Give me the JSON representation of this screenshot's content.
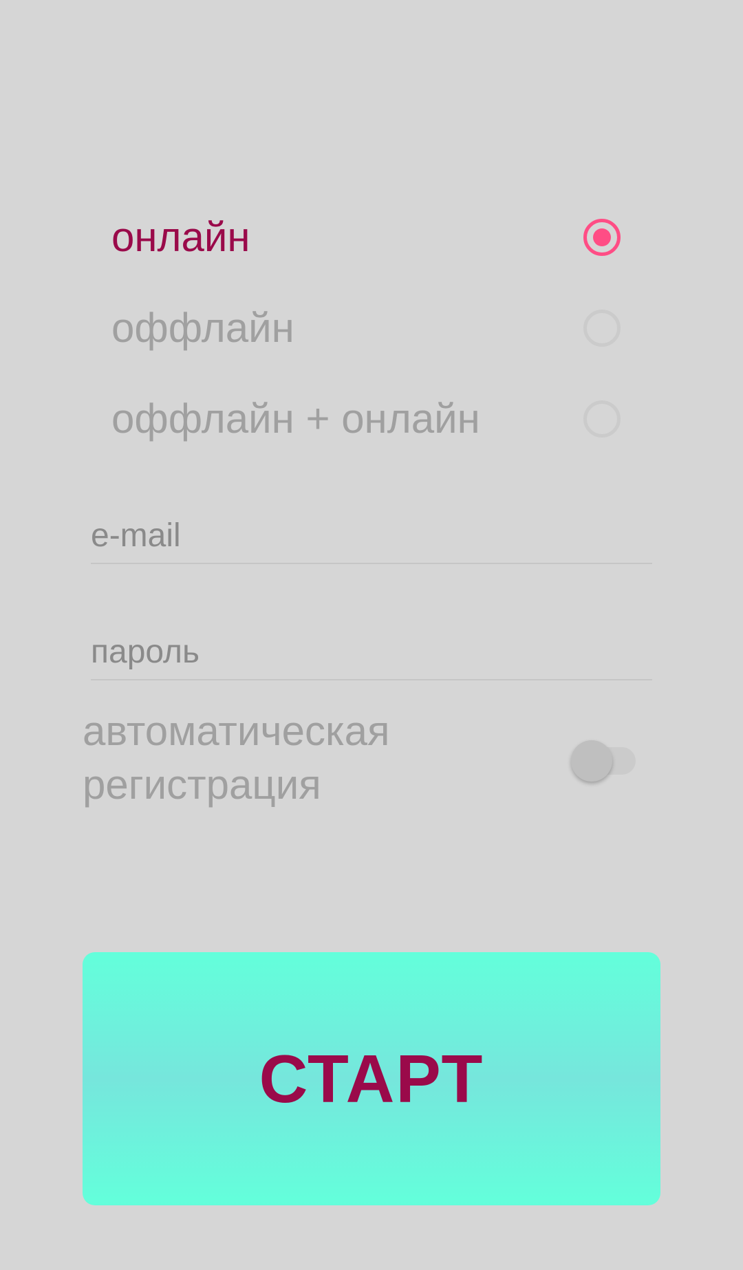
{
  "mode_options": [
    {
      "label": "онлайн",
      "selected": true
    },
    {
      "label": "оффлайн",
      "selected": false
    },
    {
      "label": "оффлайн + онлайн",
      "selected": false
    }
  ],
  "email_field": {
    "placeholder": "e-mail",
    "value": ""
  },
  "password_field": {
    "placeholder": "пароль",
    "value": ""
  },
  "auto_registration": {
    "label": "автоматическая регистрация",
    "enabled": false
  },
  "start_button": {
    "label": "СТАРТ"
  },
  "colors": {
    "background": "#d6d6d6",
    "accent": "#9a0a4a",
    "radio_selected": "#ff4d85",
    "button_gradient_edge": "#63ffdb",
    "button_gradient_mid": "#76e6dc",
    "inactive_text": "#a0a0a0"
  }
}
